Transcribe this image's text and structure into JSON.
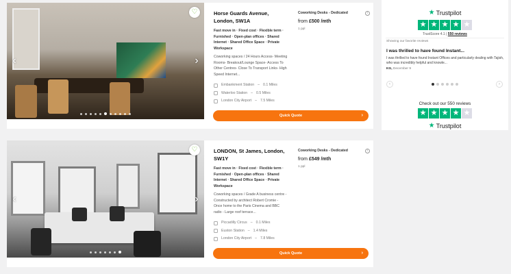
{
  "listings": [
    {
      "title": "Horse Guards Avenue, London, SW1A",
      "features": [
        "Fast move in",
        "Fixed cost",
        "Flexible term",
        "Furnished",
        "Open-plan offices",
        "Shared Internet",
        "Shared Office Space",
        "Private Workspace"
      ],
      "description": "Coworking spaces / 24 Hours Access- Meeting Rooms- Breakout/Lounge Space- Access To Other Centres- Close To Transport Links- High Speed Internet...",
      "stations": [
        {
          "name": "Embankment Station",
          "distance": "0.1 Miles"
        },
        {
          "name": "Waterloo Station",
          "distance": "0.5 Miles"
        },
        {
          "name": "London City Airport",
          "distance": "7.5 Miles"
        }
      ],
      "desk_type": "Coworking Desks - Dedicated",
      "price_prefix": "from",
      "price": "£500 /mth",
      "ppl": "1 ppl",
      "cta": "Quick Quote",
      "photo_dots": 11,
      "active_dot": 5
    },
    {
      "title": "LONDON, St James, London, SW1Y",
      "features": [
        "Fast move in",
        "Fixed cost",
        "Flexible term",
        "Furnished",
        "Open-plan offices",
        "Shared Internet",
        "Shared Office Space",
        "Private Workspace"
      ],
      "description": "Coworking spaces / Grade A business centre - Constructed by architect Robert Cromie - Once home to the Paris Cinema and BBC radio - Large roof terrace...",
      "stations": [
        {
          "name": "Piccadilly Circus",
          "distance": "0.1 Miles"
        },
        {
          "name": "Euston Station",
          "distance": "1.4 Miles"
        },
        {
          "name": "London City Airport",
          "distance": "7.8 Miles"
        }
      ],
      "desk_type": "Coworking Desks - Dedicated",
      "price_prefix": "from",
      "price": "£549 /mth",
      "ppl": "1 ppl",
      "cta": "Quick Quote",
      "photo_dots": 7,
      "active_dot": 6
    }
  ],
  "trustpilot": {
    "brand": "Trustpilot",
    "trustscore_label": "TrustScore 4.1",
    "separator": "|",
    "reviews_link": "550 reviews",
    "rating_stars": 4,
    "showing_label": "Showing our favorite reviews",
    "review_title": "I was thrilled to have found Instant...",
    "review_body": "I was thrilled to have found Instant Offices and particularly dealing with Tajish, who was incredibly helpful and knowle...",
    "review_author": "KG,",
    "review_date": "December 9",
    "dots_total": 6,
    "dots_active": 0,
    "checkout_text": "Check out our 550 reviews",
    "star_color": "#00b67a"
  },
  "colors": {
    "accent": "#f7740f",
    "heart": "#7ac143"
  }
}
